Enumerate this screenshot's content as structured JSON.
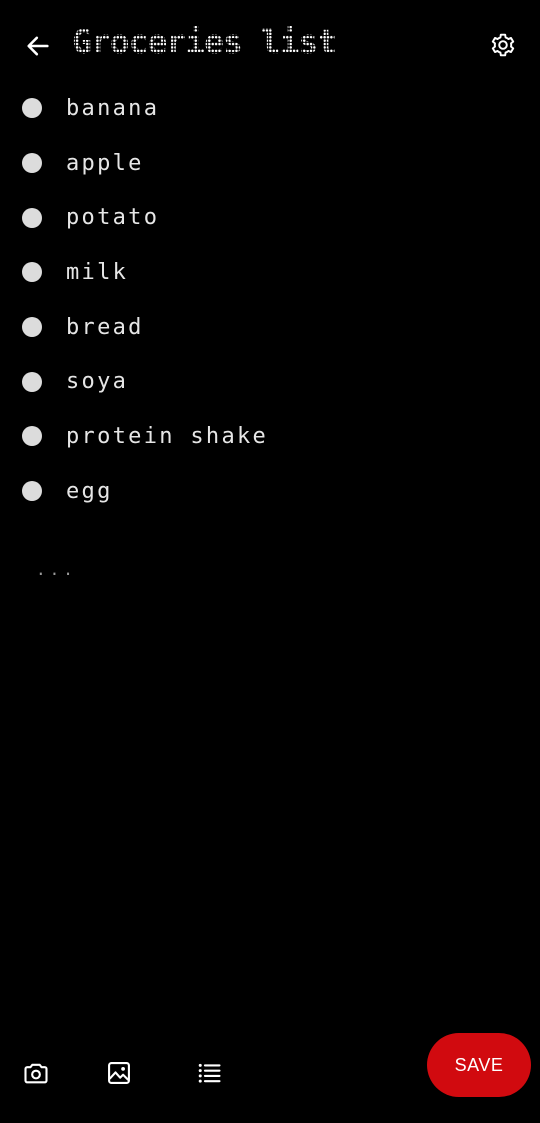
{
  "header": {
    "title": "Groceries list",
    "back_icon": "arrow-left-icon",
    "settings_icon": "gear-icon"
  },
  "list": {
    "items": [
      {
        "label": "banana"
      },
      {
        "label": "apple"
      },
      {
        "label": "potato"
      },
      {
        "label": "milk"
      },
      {
        "label": "bread"
      },
      {
        "label": "soya"
      },
      {
        "label": "protein shake"
      },
      {
        "label": "egg"
      }
    ],
    "ellipsis": "..."
  },
  "toolbar": {
    "icons": [
      "camera-icon",
      "image-icon",
      "list-icon"
    ],
    "save_label": "SAVE"
  },
  "colors": {
    "background": "#000000",
    "text": "#e6e6e6",
    "bullet": "#dcdcdc",
    "accent": "#d10a0f"
  }
}
